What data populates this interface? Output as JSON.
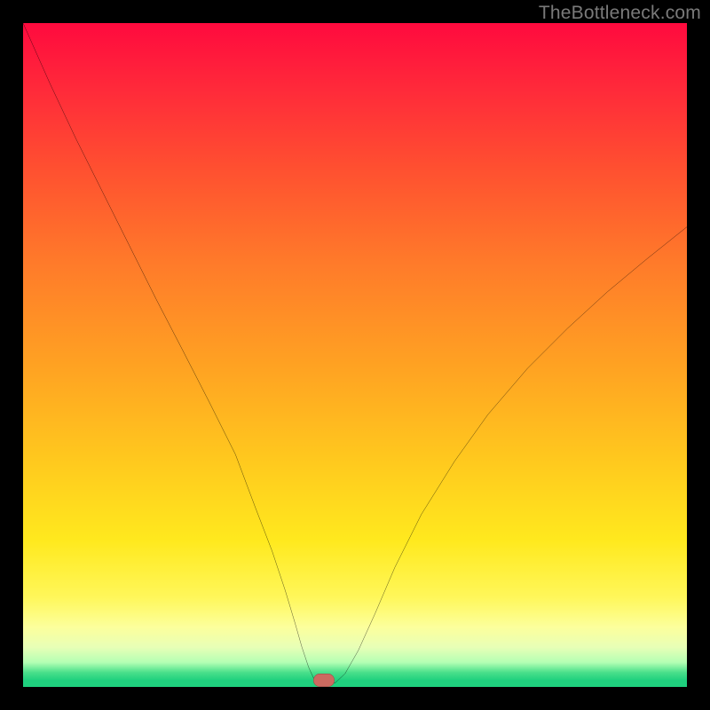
{
  "watermark": "TheBottleneck.com",
  "chart_data": {
    "type": "line",
    "title": "",
    "xlabel": "",
    "ylabel": "",
    "xlim": [
      0,
      100
    ],
    "ylim": [
      0,
      100
    ],
    "grid": false,
    "legend": false,
    "series": [
      {
        "name": "bottleneck-curve",
        "x": [
          0,
          4,
          8,
          12,
          16,
          20,
          24,
          28,
          32,
          35,
          37.5,
          39.5,
          41,
          42,
          43,
          44,
          47,
          48.5,
          50.5,
          53,
          56,
          60,
          65,
          70,
          76,
          82,
          88,
          94,
          100
        ],
        "y": [
          100,
          91,
          82.5,
          74.5,
          66.5,
          58.5,
          50.8,
          43,
          35,
          27,
          20.5,
          14.5,
          9.5,
          6,
          3,
          0.8,
          0.6,
          2,
          5.5,
          11,
          18,
          26,
          34,
          41,
          48,
          54,
          59.5,
          64.5,
          69.3
        ]
      }
    ],
    "marker": {
      "x": 45.3,
      "y": 1.0,
      "w": 3.2,
      "h": 2.0
    },
    "background_gradient": {
      "top": "#ff0a3e",
      "mid": "#ffd61f",
      "bottom": "#1fd07e"
    }
  }
}
